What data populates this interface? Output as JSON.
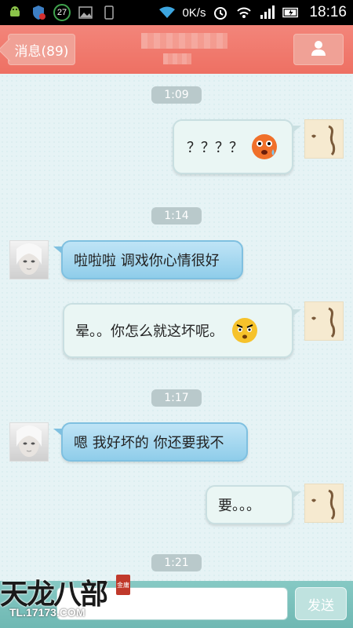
{
  "status_bar": {
    "notification_count": "27",
    "network_speed": "0K/s",
    "time": "18:16"
  },
  "header": {
    "back_label": "消息(89)"
  },
  "messages": [
    {
      "type": "time",
      "text": "1:09"
    },
    {
      "type": "out",
      "text": "？？？？",
      "emoji": "shocked-face-icon"
    },
    {
      "type": "time",
      "text": "1:14"
    },
    {
      "type": "in",
      "text": "啦啦啦 调戏你心情很好"
    },
    {
      "type": "out",
      "text": "晕。。你怎么就这坏呢。",
      "emoji": "angry-face-icon"
    },
    {
      "type": "time",
      "text": "1:17"
    },
    {
      "type": "in",
      "text": "嗯 我好坏的 你还要我不"
    },
    {
      "type": "out",
      "text": "要。。。"
    },
    {
      "type": "time",
      "text": "1:21"
    }
  ],
  "input_bar": {
    "placeholder": "",
    "send_label": "发送"
  },
  "watermark": {
    "title": "天龙八部",
    "url": "TL.17173.COM",
    "seal": "金庸"
  },
  "colors": {
    "header": "#f07a6d",
    "incoming_bubble": "#9fd4ee",
    "outgoing_bubble": "#eaf6f4",
    "input_bar": "#7cc2bd"
  }
}
